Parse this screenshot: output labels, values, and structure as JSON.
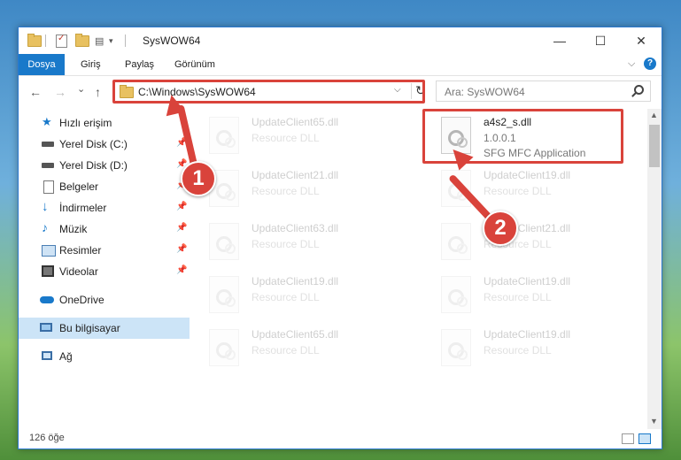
{
  "window": {
    "title": "SysWOW64"
  },
  "ribbon": {
    "tabs": [
      "Dosya",
      "Giriş",
      "Paylaş",
      "Görünüm"
    ],
    "help": "?"
  },
  "address": {
    "path": "C:\\Windows\\SysWOW64",
    "refresh": "↻",
    "dropdown": "⌵"
  },
  "search": {
    "placeholder": "Ara: SysWOW64"
  },
  "nav": {
    "back": "←",
    "forward": "→",
    "recent": "⌄",
    "up": "↑"
  },
  "sidebar": {
    "items": [
      {
        "label": "Hızlı erişim",
        "icon": "star-icon",
        "pinned": false
      },
      {
        "label": "Yerel Disk (C:)",
        "icon": "drive-icon",
        "pinned": true
      },
      {
        "label": "Yerel Disk (D:)",
        "icon": "drive-icon",
        "pinned": true
      },
      {
        "label": "Belgeler",
        "icon": "documents-icon",
        "pinned": true
      },
      {
        "label": "İndirmeler",
        "icon": "download-icon",
        "pinned": true
      },
      {
        "label": "Müzik",
        "icon": "music-icon",
        "pinned": true
      },
      {
        "label": "Resimler",
        "icon": "pictures-icon",
        "pinned": true
      },
      {
        "label": "Videolar",
        "icon": "videos-icon",
        "pinned": true
      },
      {
        "label": "OneDrive",
        "icon": "cloud-icon",
        "pinned": false
      },
      {
        "label": "Bu bilgisayar",
        "icon": "computer-icon",
        "pinned": false,
        "selected": true
      },
      {
        "label": "Ağ",
        "icon": "network-icon",
        "pinned": false
      }
    ]
  },
  "files": {
    "left": [
      {
        "name": "UpdateClient65.dll",
        "sub": "Resource DLL"
      },
      {
        "name": "UpdateClient21.dll",
        "sub": "Resource DLL"
      },
      {
        "name": "UpdateClient63.dll",
        "sub": "Resource DLL"
      },
      {
        "name": "UpdateClient19.dll",
        "sub": "Resource DLL"
      },
      {
        "name": "UpdateClient65.dll",
        "sub": "Resource DLL"
      }
    ],
    "right": [
      {
        "name": "a4s2_s.dll",
        "version": "1.0.0.1",
        "sub": "SFG MFC Application",
        "highlighted": true
      },
      {
        "name": "UpdateClient19.dll",
        "sub": "Resource DLL"
      },
      {
        "name": "UpdateClient21.dll",
        "sub": "Resource DLL"
      },
      {
        "name": "UpdateClient19.dll",
        "sub": "Resource DLL"
      },
      {
        "name": "UpdateClient19.dll",
        "sub": "Resource DLL"
      }
    ]
  },
  "status": {
    "item_count": "126 öğe"
  },
  "annotations": {
    "step1": "1",
    "step2": "2"
  },
  "colors": {
    "accent": "#1979ca",
    "highlight": "#d9433b",
    "selected": "#cce4f7"
  }
}
